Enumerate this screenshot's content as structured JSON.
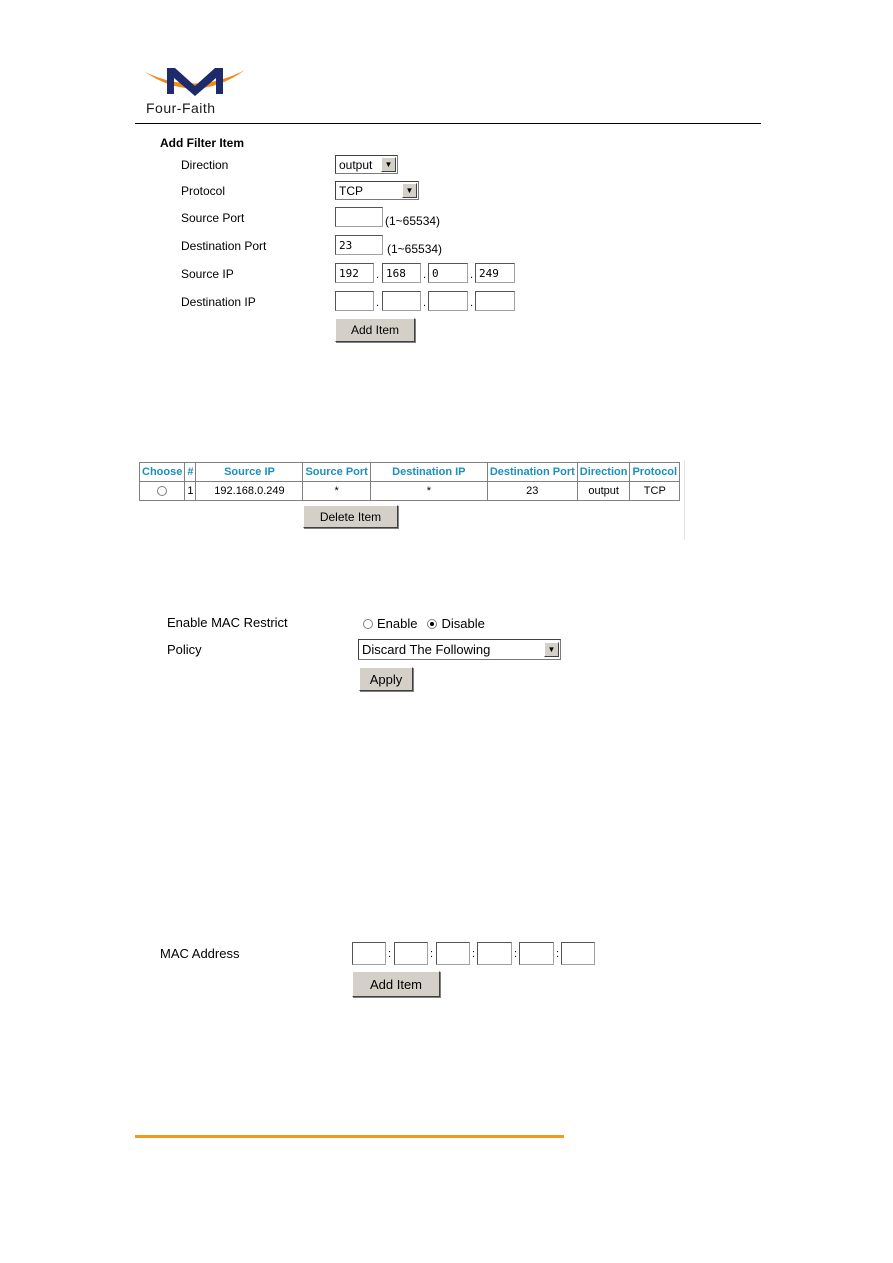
{
  "header": {
    "logo_text": "Four-Faith",
    "colors": {
      "logo_blue": "#1d2a6b",
      "logo_orange": "#f08a1c",
      "footer_line": "#f39a1e",
      "table_header": "#1b8fbf"
    }
  },
  "filter_form": {
    "title": "Add Filter Item",
    "direction": {
      "label": "Direction",
      "value": "output"
    },
    "protocol": {
      "label": "Protocol",
      "value": "TCP"
    },
    "source_port": {
      "label": "Source Port",
      "value": "",
      "hint": "(1~65534)"
    },
    "destination_port": {
      "label": "Destination Port",
      "value": "23",
      "hint": "(1~65534)"
    },
    "source_ip": {
      "label": "Source IP",
      "octets": [
        "192",
        "168",
        "0",
        "249"
      ]
    },
    "destination_ip": {
      "label": "Destination IP",
      "octets": [
        "",
        "",
        "",
        ""
      ]
    },
    "add_button": "Add Item",
    "separator": "."
  },
  "filter_table": {
    "columns": [
      "Choose",
      "#",
      "Source IP",
      "Source Port",
      "Destination IP",
      "Destination Port",
      "Direction",
      "Protocol"
    ],
    "rows": [
      {
        "index": "1",
        "source_ip": "192.168.0.249",
        "source_port": "*",
        "destination_ip": "*",
        "destination_port": "23",
        "direction": "output",
        "protocol": "TCP"
      }
    ],
    "delete_button": "Delete Item"
  },
  "mac_restrict": {
    "label": "Enable MAC Restrict",
    "enable_label": "Enable",
    "disable_label": "Disable",
    "selected": "Disable",
    "policy_label": "Policy",
    "policy_value": "Discard The Following",
    "apply_button": "Apply"
  },
  "mac_form": {
    "label": "MAC Address",
    "octets": [
      "",
      "",
      "",
      "",
      "",
      ""
    ],
    "separator": ":",
    "add_button": "Add Item"
  }
}
